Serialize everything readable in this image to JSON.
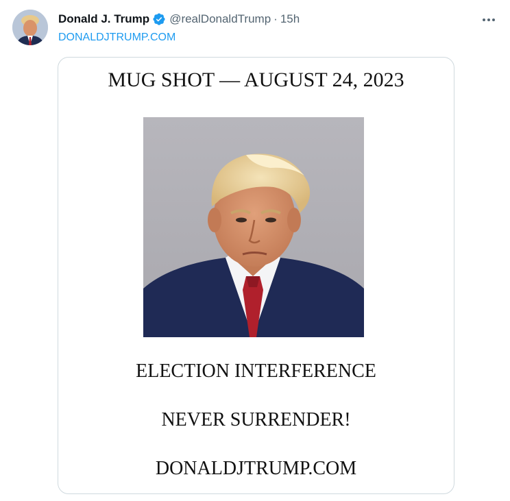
{
  "author": {
    "display_name": "Donald J. Trump",
    "handle": "@realDonaldTrump",
    "separator": "·",
    "timestamp": "15h",
    "verified_icon": "verified-badge-icon",
    "avatar_icon": "avatar"
  },
  "tweet": {
    "link_text": "DONALDJTRUMP.COM"
  },
  "media": {
    "title": "MUG SHOT — AUGUST 24, 2023",
    "line1": "ELECTION INTERFERENCE",
    "line2": "NEVER SURRENDER!",
    "line3": "DONALDJTRUMP.COM"
  },
  "colors": {
    "accent": "#1d9bf0",
    "secondary_text": "#536471",
    "primary_text": "#0f1419",
    "border": "#cfd9de"
  }
}
